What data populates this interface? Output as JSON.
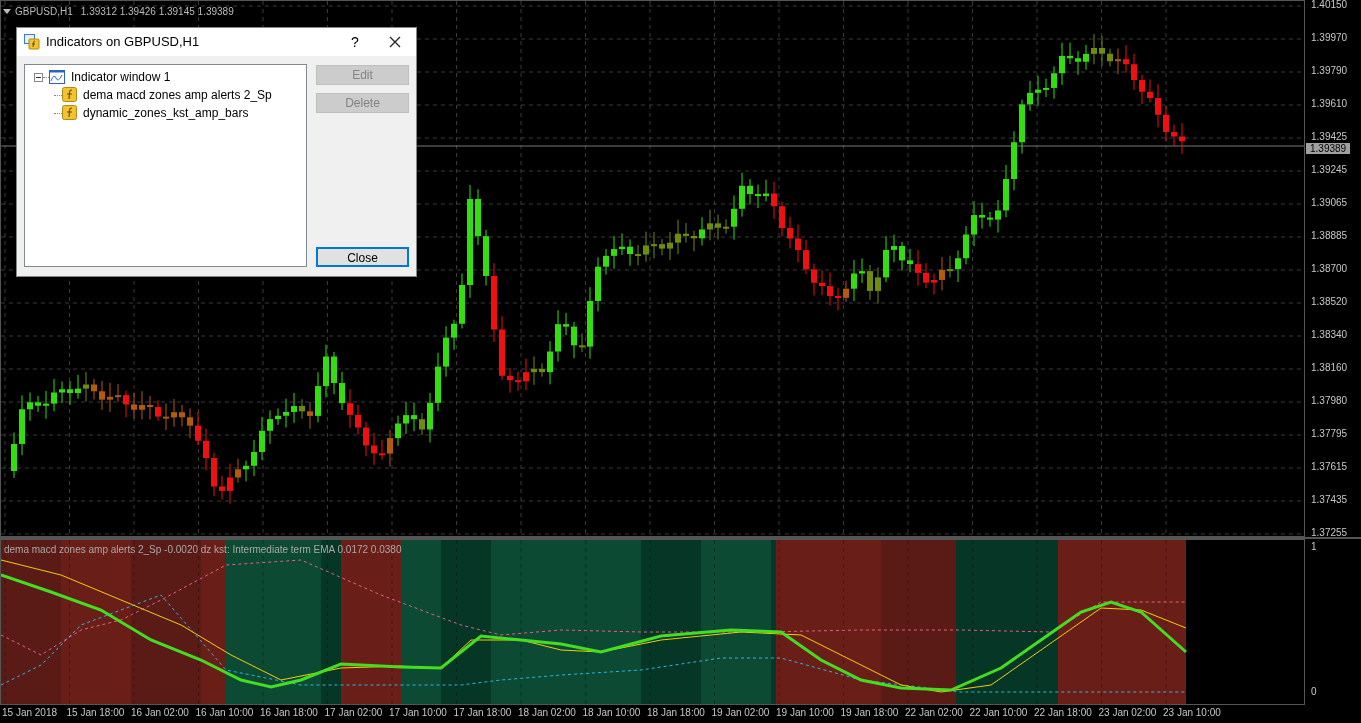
{
  "chart": {
    "symbol_label": "GBPUSD,H1",
    "ohlc": [
      "1.39312",
      "1.39426",
      "1.39145",
      "1.39389"
    ],
    "price_axis": [
      "1.40150",
      "1.39970",
      "1.39790",
      "1.39610",
      "1.39425",
      "1.39245",
      "1.39065",
      "1.38885",
      "1.38700",
      "1.38520",
      "1.38340",
      "1.38160",
      "1.37980",
      "1.37795",
      "1.37615",
      "1.37435",
      "1.37255"
    ],
    "current_price": "1.39389",
    "time_axis": [
      "15 Jan 2018",
      "15 Jan 18:00",
      "16 Jan 02:00",
      "16 Jan 10:00",
      "16 Jan 18:00",
      "17 Jan 02:00",
      "17 Jan 10:00",
      "17 Jan 18:00",
      "18 Jan 02:00",
      "18 Jan 10:00",
      "18 Jan 18:00",
      "19 Jan 02:00",
      "19 Jan 10:00",
      "19 Jan 18:00",
      "22 Jan 02:00",
      "22 Jan 10:00",
      "22 Jan 18:00",
      "23 Jan 02:00",
      "23 Jan 10:00"
    ]
  },
  "indicator_pane": {
    "label": "dema macd zones amp alerts 2_Sp -0.0020 dz kst: Intermediate term EMA 0.0172 0.0380",
    "scale": [
      "1",
      "0"
    ]
  },
  "dialog": {
    "title": "Indicators on GBPUSD,H1",
    "help": "?",
    "tree": [
      {
        "label": "Indicator window 1",
        "expanded": true,
        "children": [
          {
            "label": "dema macd zones amp alerts 2_Sp"
          },
          {
            "label": "dynamic_zones_kst_amp_bars"
          }
        ]
      }
    ],
    "buttons": [
      {
        "label": "Edit",
        "disabled": true,
        "default": false
      },
      {
        "label": "Delete",
        "disabled": true,
        "default": false
      },
      {
        "label": "Close",
        "disabled": false,
        "default": true
      }
    ]
  }
}
